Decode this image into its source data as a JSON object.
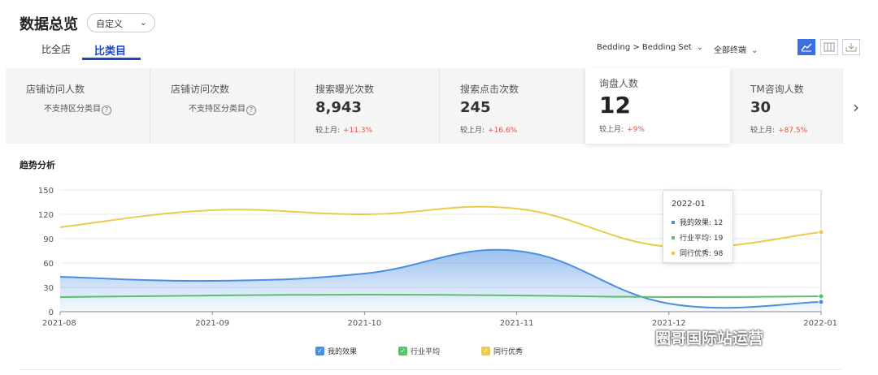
{
  "header": {
    "title": "数据总览",
    "range_select": "自定义",
    "tabs": [
      "比全店",
      "比类目"
    ],
    "category_filter": "Bedding > Bedding Set",
    "terminal_filter": "全部终端"
  },
  "metrics": [
    {
      "name": "店铺访问人数",
      "na": "不支持区分类目"
    },
    {
      "name": "店铺访问次数",
      "na": "不支持区分类目"
    },
    {
      "name": "搜索曝光次数",
      "value": "8,943",
      "cmp_label": "较上月:",
      "cmp": "+11.3%"
    },
    {
      "name": "搜索点击次数",
      "value": "245",
      "cmp_label": "较上月:",
      "cmp": "+16.6%"
    },
    {
      "name": "询盘人数",
      "value": "12",
      "cmp_label": "较上月:",
      "cmp": "+9%"
    },
    {
      "name": "TM咨询人数",
      "value": "30",
      "cmp_label": "较上月:",
      "cmp": "+87.5%"
    }
  ],
  "trend": {
    "title": "趋势分析",
    "tooltip": {
      "title": "2022-01",
      "rows": [
        {
          "label": "我的效果: 12"
        },
        {
          "label": "行业平均: 19"
        },
        {
          "label": "同行优秀: 98"
        }
      ]
    }
  },
  "watermark": "圈哥国际站运营",
  "colors": {
    "blue": "#4a8fe2",
    "green": "#5cbf6a",
    "yellow": "#e9cb4e",
    "accent": "#1d45c8",
    "negative_pct": "#e0524a"
  },
  "chart_data": {
    "type": "area",
    "categories": [
      "2021-08",
      "2021-09",
      "2021-10",
      "2021-11",
      "2021-12",
      "2022-01"
    ],
    "series": [
      {
        "name": "我的效果",
        "values": [
          43,
          38,
          47,
          75,
          10,
          12
        ],
        "color": "#4a8fe2"
      },
      {
        "name": "行业平均",
        "values": [
          18,
          20,
          21,
          20,
          18,
          19
        ],
        "color": "#5cbf6a"
      },
      {
        "name": "同行优秀",
        "values": [
          104,
          125,
          120,
          127,
          80,
          98
        ],
        "color": "#e9cb4e"
      }
    ],
    "yticks": [
      "0",
      "30",
      "60",
      "90",
      "120",
      "150"
    ],
    "ylim": [
      0,
      150
    ],
    "grid": true,
    "legend_position": "bottom"
  }
}
